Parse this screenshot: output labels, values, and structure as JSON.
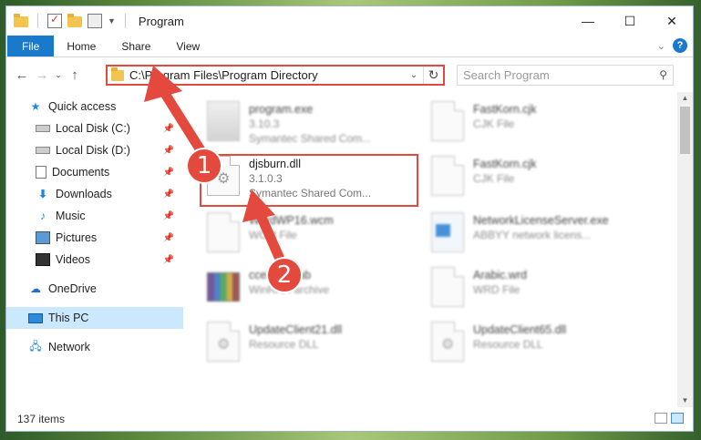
{
  "window": {
    "title": "Program",
    "controls": {
      "minimize": "—",
      "maximize": "☐",
      "close": "✕"
    }
  },
  "ribbon": {
    "tabs": [
      "File",
      "Home",
      "Share",
      "View"
    ],
    "help": "?"
  },
  "navigation": {
    "address": "C:\\Program Files\\Program Directory",
    "search_placeholder": "Search Program"
  },
  "sidebar": {
    "quick_access": "Quick access",
    "pinned": [
      {
        "label": "Local Disk (C:)",
        "icon": "drive-icon"
      },
      {
        "label": "Local Disk (D:)",
        "icon": "drive-icon"
      },
      {
        "label": "Documents",
        "icon": "documents-icon"
      },
      {
        "label": "Downloads",
        "icon": "downloads-icon"
      },
      {
        "label": "Music",
        "icon": "music-icon"
      },
      {
        "label": "Pictures",
        "icon": "pictures-icon"
      },
      {
        "label": "Videos",
        "icon": "videos-icon"
      }
    ],
    "onedrive": "OneDrive",
    "this_pc": "This PC",
    "network": "Network"
  },
  "files": [
    {
      "name": "program.exe",
      "line2": "3.10.3",
      "line3": "Symantec Shared Com...",
      "icon": "exe-icon"
    },
    {
      "name": "FastKorn.cjk",
      "line2": "CJK File",
      "line3": "",
      "icon": "file-icon"
    },
    {
      "name": "djsburn.dll",
      "line2": "3.1.0.3",
      "line3": "Symantec Shared Com...",
      "icon": "dll-icon"
    },
    {
      "name": "FastKorn.cjk",
      "line2": "CJK File",
      "line3": "",
      "icon": "file-icon"
    },
    {
      "name": "WordWP16.wcm",
      "line2": "WCM File",
      "line3": "",
      "icon": "file-icon"
    },
    {
      "name": "NetworkLicenseServer.exe",
      "line2": "ABBYY network licens...",
      "line3": "",
      "icon": "exe-icon"
    },
    {
      "name": "ccelfiles.cab",
      "line2": "WinRAR archive",
      "line3": "",
      "icon": "archive-icon"
    },
    {
      "name": "Arabic.wrd",
      "line2": "WRD File",
      "line3": "",
      "icon": "file-icon"
    },
    {
      "name": "UpdateClient21.dll",
      "line2": "Resource DLL",
      "line3": "",
      "icon": "dll-icon"
    },
    {
      "name": "UpdateClient65.dll",
      "line2": "Resource DLL",
      "line3": "",
      "icon": "dll-icon"
    }
  ],
  "status": {
    "item_count": "137 items"
  },
  "annotations": {
    "step1": "1",
    "step2": "2",
    "color": "#e34a3d"
  }
}
